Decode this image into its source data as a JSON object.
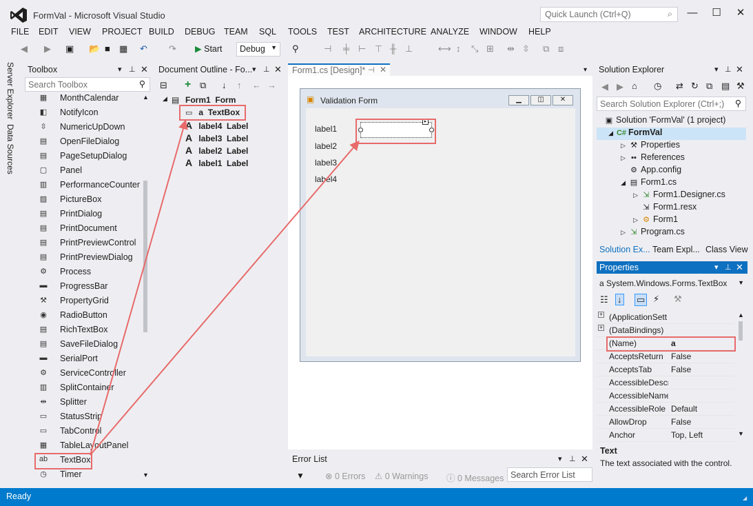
{
  "window": {
    "title": "FormVal - Microsoft Visual Studio",
    "quick_launch_placeholder": "Quick Launch (Ctrl+Q)",
    "controls": [
      "—",
      "☐",
      "✕"
    ]
  },
  "menu": [
    "FILE",
    "EDIT",
    "VIEW",
    "PROJECT",
    "BUILD",
    "DEBUG",
    "TEAM",
    "SQL",
    "TOOLS",
    "TEST",
    "ARCHITECTURE",
    "ANALYZE",
    "WINDOW",
    "HELP"
  ],
  "toolbar": {
    "start_label": "Start",
    "config_value": "Debug"
  },
  "side_tabs": [
    "Server Explorer",
    "Data Sources"
  ],
  "toolbox": {
    "title": "Toolbox",
    "search_placeholder": "Search Toolbox",
    "items": [
      "MonthCalendar",
      "NotifyIcon",
      "NumericUpDown",
      "OpenFileDialog",
      "PageSetupDialog",
      "Panel",
      "PerformanceCounter",
      "PictureBox",
      "PrintDialog",
      "PrintDocument",
      "PrintPreviewControl",
      "PrintPreviewDialog",
      "Process",
      "ProgressBar",
      "PropertyGrid",
      "RadioButton",
      "RichTextBox",
      "SaveFileDialog",
      "SerialPort",
      "ServiceController",
      "SplitContainer",
      "Splitter",
      "StatusStrip",
      "TabControl",
      "TableLayoutPanel",
      "TextBox",
      "Timer"
    ],
    "highlighted": "TextBox"
  },
  "document_outline": {
    "title": "Document Outline - Fo...",
    "root": {
      "name": "Form1",
      "type": "Form"
    },
    "children": [
      {
        "name": "a",
        "type": "TextBox"
      },
      {
        "name": "label4",
        "type": "Label"
      },
      {
        "name": "label3",
        "type": "Label"
      },
      {
        "name": "label2",
        "type": "Label"
      },
      {
        "name": "label1",
        "type": "Label"
      }
    ]
  },
  "designer": {
    "tab_label": "Form1.cs [Design]*",
    "form_title": "Validation Form",
    "labels": [
      "label1",
      "label2",
      "label3",
      "label4"
    ]
  },
  "error_list": {
    "title": "Error List",
    "errors": "0 Errors",
    "warnings": "0 Warnings",
    "messages": "0 Messages",
    "search_placeholder": "Search Error List"
  },
  "solution_explorer": {
    "title": "Solution Explorer",
    "search_placeholder": "Search Solution Explorer (Ctrl+;)",
    "tree": [
      {
        "label": "Solution 'FormVal' (1 project)",
        "indent": 0,
        "toggle": "",
        "icon": "solution-icon"
      },
      {
        "label": "FormVal",
        "indent": 1,
        "toggle": "◢",
        "icon": "csharp-project-icon",
        "selected": true
      },
      {
        "label": "Properties",
        "indent": 2,
        "toggle": "▷",
        "icon": "wrench-icon"
      },
      {
        "label": "References",
        "indent": 2,
        "toggle": "▷",
        "icon": "references-icon"
      },
      {
        "label": "App.config",
        "indent": 2,
        "toggle": "",
        "icon": "config-file-icon"
      },
      {
        "label": "Form1.cs",
        "indent": 2,
        "toggle": "◢",
        "icon": "form-icon"
      },
      {
        "label": "Form1.Designer.cs",
        "indent": 3,
        "toggle": "▷",
        "icon": "cs-file-icon"
      },
      {
        "label": "Form1.resx",
        "indent": 3,
        "toggle": "",
        "icon": "resx-file-icon"
      },
      {
        "label": "Form1",
        "indent": 3,
        "toggle": "▷",
        "icon": "class-icon"
      },
      {
        "label": "Program.cs",
        "indent": 2,
        "toggle": "▷",
        "icon": "cs-file-icon"
      }
    ],
    "bottom_tabs": [
      "Solution Ex...",
      "Team Expl...",
      "Class View"
    ]
  },
  "properties": {
    "title": "Properties",
    "object": "a  System.Windows.Forms.TextBox",
    "rows": [
      {
        "name": "(ApplicationSett",
        "value": "",
        "expandable": true
      },
      {
        "name": "(DataBindings)",
        "value": "",
        "expandable": true
      },
      {
        "name": "(Name)",
        "value": "a",
        "expandable": false,
        "highlight": true
      },
      {
        "name": "AcceptsReturn",
        "value": "False",
        "expandable": false
      },
      {
        "name": "AcceptsTab",
        "value": "False",
        "expandable": false
      },
      {
        "name": "AccessibleDescr",
        "value": "",
        "expandable": false
      },
      {
        "name": "AccessibleName",
        "value": "",
        "expandable": false
      },
      {
        "name": "AccessibleRole",
        "value": "Default",
        "expandable": false
      },
      {
        "name": "AllowDrop",
        "value": "False",
        "expandable": false
      },
      {
        "name": "Anchor",
        "value": "Top, Left",
        "expandable": false
      }
    ],
    "description_title": "Text",
    "description_text": "The text associated with the control."
  },
  "status": {
    "text": "Ready"
  },
  "colors": {
    "accent": "#007acc",
    "highlight": "#e86a6a",
    "panel_header": "#0e70c0"
  }
}
